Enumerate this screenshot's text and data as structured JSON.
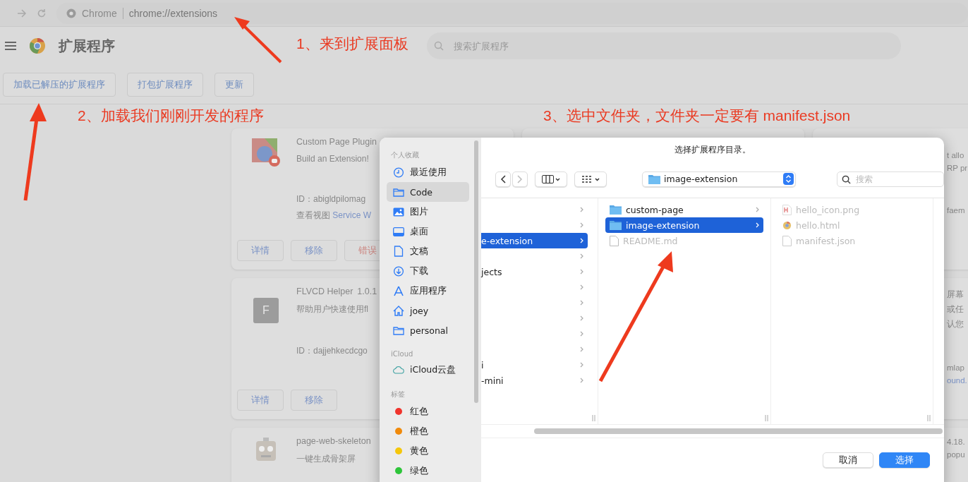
{
  "browser": {
    "site_label": "Chrome",
    "url": "chrome://extensions"
  },
  "header": {
    "title": "扩展程序",
    "search_placeholder": "搜索扩展程序"
  },
  "toolbar": [
    "加载已解压的扩展程序",
    "打包扩展程序",
    "更新"
  ],
  "cards": [
    {
      "name": "Custom Page Plugin",
      "description": "Build an Extension!",
      "id": "ID：abigldpilomag",
      "views_label": "查看视图",
      "views_link": "Service W",
      "buttons": [
        {
          "label": "详情",
          "kind": "normal"
        },
        {
          "label": "移除",
          "kind": "normal"
        },
        {
          "label": "错误",
          "kind": "error"
        }
      ]
    },
    {
      "letter": "F",
      "name": "FLVCD Helper",
      "version": "1.0.1",
      "description": "帮助用户快速使用fl",
      "id": "ID：dajjehkecdcgo",
      "buttons": [
        {
          "label": "详情",
          "kind": "normal"
        },
        {
          "label": "移除",
          "kind": "normal"
        }
      ]
    },
    {
      "name": "page-web-skeleton",
      "description": "一键生成骨架屏"
    }
  ],
  "right_cards": [
    [
      {
        "text": "t allo",
        "kind": "text"
      },
      {
        "text": "RP pr",
        "kind": "text"
      },
      {
        "text": "faem",
        "kind": "text"
      }
    ],
    [
      {
        "text": "屏幕",
        "kind": "text"
      },
      {
        "text": "或任",
        "kind": "text"
      },
      {
        "text": "认您",
        "kind": "text"
      },
      {
        "text": "mlap",
        "kind": "text"
      },
      {
        "text": "ound.",
        "kind": "link"
      }
    ],
    [
      {
        "text": "4.18.",
        "kind": "text"
      },
      {
        "text": "popu",
        "kind": "text"
      }
    ]
  ],
  "dialog": {
    "title": "选择扩展程序目录。",
    "path": "image-extension",
    "search_placeholder": "搜索",
    "sidebar": [
      {
        "heading": "个人收藏",
        "items": [
          {
            "label": "最近使用",
            "kind": "clock",
            "selected": false
          },
          {
            "label": "Code",
            "kind": "folder",
            "selected": true
          },
          {
            "label": "图片",
            "kind": "photo",
            "selected": false
          },
          {
            "label": "桌面",
            "kind": "desktop",
            "selected": false
          },
          {
            "label": "文稿",
            "kind": "doc",
            "selected": false
          },
          {
            "label": "下载",
            "kind": "download",
            "selected": false
          },
          {
            "label": "应用程序",
            "kind": "apps",
            "selected": false
          },
          {
            "label": "joey",
            "kind": "home",
            "selected": false
          },
          {
            "label": "personal",
            "kind": "folder",
            "selected": false
          }
        ]
      },
      {
        "heading": "iCloud",
        "items": [
          {
            "label": "iCloud云盘",
            "kind": "cloud",
            "selected": false
          }
        ]
      },
      {
        "heading": "标签",
        "items": [
          {
            "label": "红色",
            "kind": "tag",
            "color": "#f0342c",
            "selected": false
          },
          {
            "label": "橙色",
            "kind": "tag",
            "color": "#f08a0b",
            "selected": false
          },
          {
            "label": "黄色",
            "kind": "tag",
            "color": "#f5c60b",
            "selected": false
          },
          {
            "label": "绿色",
            "kind": "tag",
            "color": "#2ec53a",
            "selected": false
          }
        ]
      }
    ],
    "column_1": [
      {
        "selected": false
      },
      {
        "selected": false
      },
      {
        "label": "e-extension",
        "selected": true
      },
      {
        "selected": false
      },
      {
        "label": "jects",
        "selected": false
      },
      {
        "selected": false
      },
      {
        "selected": false
      },
      {
        "selected": false
      },
      {
        "selected": false
      },
      {
        "selected": false
      },
      {
        "label": "i",
        "selected": false
      },
      {
        "label": "-mini",
        "selected": false
      }
    ],
    "column_2": [
      {
        "label": "custom-page",
        "kind": "folder",
        "selected": false,
        "disabled": false
      },
      {
        "label": "image-extension",
        "kind": "folder",
        "selected": true,
        "disabled": false
      },
      {
        "label": "README.md",
        "kind": "file",
        "selected": false,
        "disabled": true
      }
    ],
    "column_3": [
      {
        "label": "hello_icon.png",
        "kind": "image",
        "disabled": true
      },
      {
        "label": "hello.html",
        "kind": "html",
        "disabled": true
      },
      {
        "label": "manifest.json",
        "kind": "file",
        "disabled": true
      }
    ],
    "buttons": [
      {
        "label": "取消",
        "kind": "cancel"
      },
      {
        "label": "选择",
        "kind": "primary"
      }
    ]
  },
  "annotations": [
    "1、来到扩展面板",
    "2、加载我们刚刚开发的程序",
    "3、选中文件夹，文件夹一定要有 manifest.json"
  ]
}
